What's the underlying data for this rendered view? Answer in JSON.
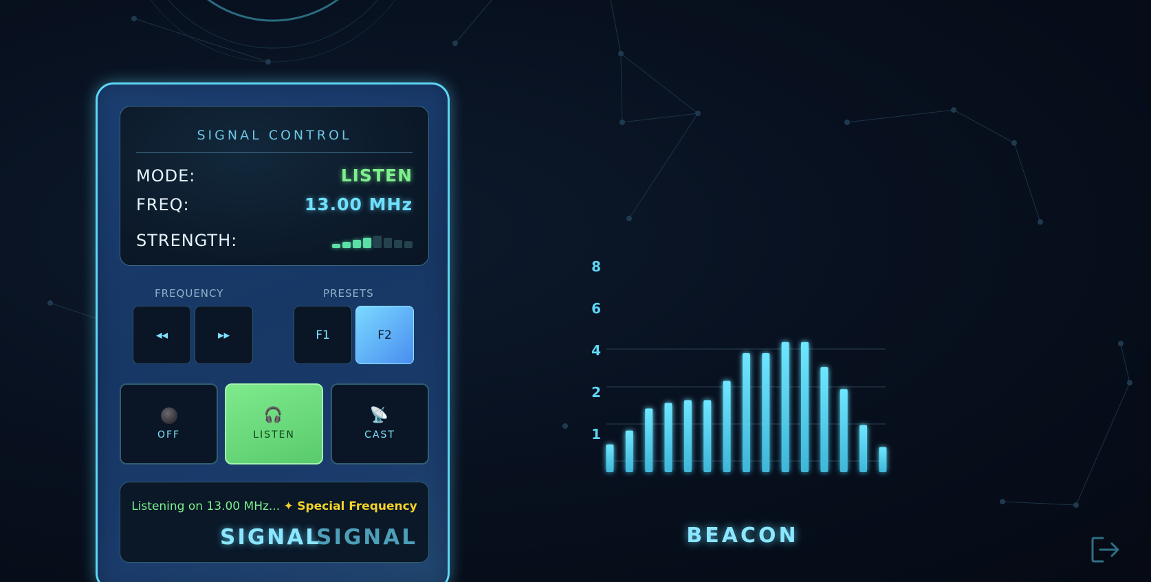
{
  "panel": {
    "display": {
      "title": "SIGNAL CONTROL",
      "mode_label": "MODE:",
      "mode_value": "LISTEN",
      "freq_label": "FREQ:",
      "freq_value": "13.00 MHz",
      "strength_label": "STRENGTH:",
      "strength_level": 4,
      "strength_max": 8
    },
    "frequency_group": {
      "label": "FREQUENCY",
      "down_icon": "rewind-icon",
      "down_label": "◂◂",
      "up_icon": "fast-forward-icon",
      "up_label": "▸▸"
    },
    "presets_group": {
      "label": "PRESETS",
      "buttons": [
        {
          "label": "F1",
          "active": false
        },
        {
          "label": "F2",
          "active": true
        }
      ]
    },
    "modes": [
      {
        "label": "OFF",
        "icon": "power-off-dot-icon",
        "active": false
      },
      {
        "label": "LISTEN",
        "icon": "headphones-icon",
        "glyph": "🎧",
        "active": true
      },
      {
        "label": "CAST",
        "icon": "satellite-dish-icon",
        "glyph": "📡",
        "active": false
      }
    ],
    "status": {
      "text": "Listening on 13.00 MHz...",
      "special_prefix": "✦",
      "special_text": "Special Frequency",
      "logo_primary": "SIGNAL",
      "logo_secondary": "SIGNAL"
    }
  },
  "beacon_label": "BEACON",
  "exit_icon": "logout-icon",
  "colors": {
    "accent": "#5fd6f5",
    "listen_green": "#7df08d",
    "special_yellow": "#f5d327",
    "bar": "#5fd6f5"
  },
  "chart_data": {
    "type": "bar",
    "y_ticks": [
      "1",
      "2",
      "4",
      "6",
      "8"
    ],
    "values": [
      1.0,
      1.5,
      2.3,
      2.5,
      2.6,
      2.6,
      3.3,
      4.3,
      4.3,
      4.7,
      4.7,
      3.8,
      3.0,
      1.7,
      0.9
    ],
    "ylim": [
      0,
      8
    ],
    "grid": true
  }
}
